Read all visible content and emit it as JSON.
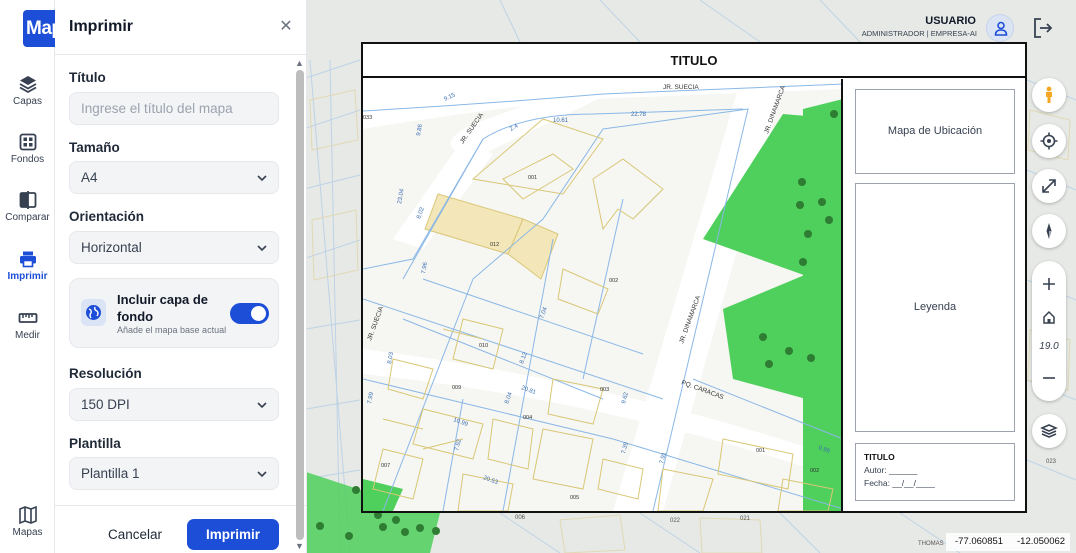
{
  "app": {
    "logo_text": "Map"
  },
  "nav": [
    {
      "key": "capas",
      "label": "Capas",
      "icon": "layers-icon",
      "active": false
    },
    {
      "key": "fondos",
      "label": "Fondos",
      "icon": "basemap-grid-icon",
      "active": false
    },
    {
      "key": "comparar",
      "label": "Comparar",
      "icon": "compare-icon",
      "active": false
    },
    {
      "key": "imprimir",
      "label": "Imprimir",
      "icon": "printer-icon",
      "active": true
    },
    {
      "key": "medir",
      "label": "Medir",
      "icon": "ruler-icon",
      "active": false
    },
    {
      "key": "mapas",
      "label": "Mapas",
      "icon": "map-icon",
      "active": false
    }
  ],
  "panel": {
    "title": "Imprimir",
    "close_icon": "close-icon",
    "titulo": {
      "label": "Título",
      "value": "",
      "placeholder": "Ingrese el título del mapa"
    },
    "tamano": {
      "label": "Tamaño",
      "value": "A4"
    },
    "orientacion": {
      "label": "Orientación",
      "value": "Horizontal"
    },
    "background": {
      "title": "Incluir capa de fondo",
      "subtitle": "Añade el mapa base actual",
      "enabled": true
    },
    "resolucion": {
      "label": "Resolución",
      "value": "150 DPI"
    },
    "plantilla": {
      "label": "Plantilla",
      "value": "Plantilla 1"
    },
    "cancel_label": "Cancelar",
    "print_label": "Imprimir"
  },
  "user": {
    "name": "USUARIO",
    "role": "ADMINISTRADOR | EMPRESA-AI"
  },
  "preview": {
    "title": "TITULO",
    "location_label": "Mapa de Ubicación",
    "legend_label": "Leyenda",
    "titlebox": {
      "title": "TITULO",
      "author": "Autor: ______",
      "date": "Fecha: __/__/____"
    },
    "map_labels": {
      "streets": [
        "JR. SUECIA",
        "JR. SUECIA",
        "JR. DINAMARCA",
        "JR. DINAMARCA",
        "JR. SUECIA",
        "PQ. CARACAS"
      ],
      "lots": [
        "001",
        "002",
        "003",
        "004",
        "005",
        "007",
        "009",
        "010",
        "012",
        "001",
        "002",
        "033"
      ],
      "dims": [
        "10.61",
        "22.78",
        "23.04",
        "9.86",
        "8.02",
        "7.96",
        "8.03",
        "7.04",
        "8.12",
        "8.04",
        "20.81",
        "10.99",
        "7.92",
        "20.53",
        "7.99",
        "9.62",
        "7.39",
        "7.91",
        "9.15",
        "2.4",
        "9.99"
      ]
    }
  },
  "toolbar": {
    "zoom_level": "19.0"
  },
  "coords": {
    "lon": "-77.060851",
    "lat": "-12.050062"
  },
  "colors": {
    "accent": "#1d4ed8",
    "park": "#4fcf5c",
    "parcel_line": "#d9c776",
    "street_line": "#8ab8e6"
  }
}
